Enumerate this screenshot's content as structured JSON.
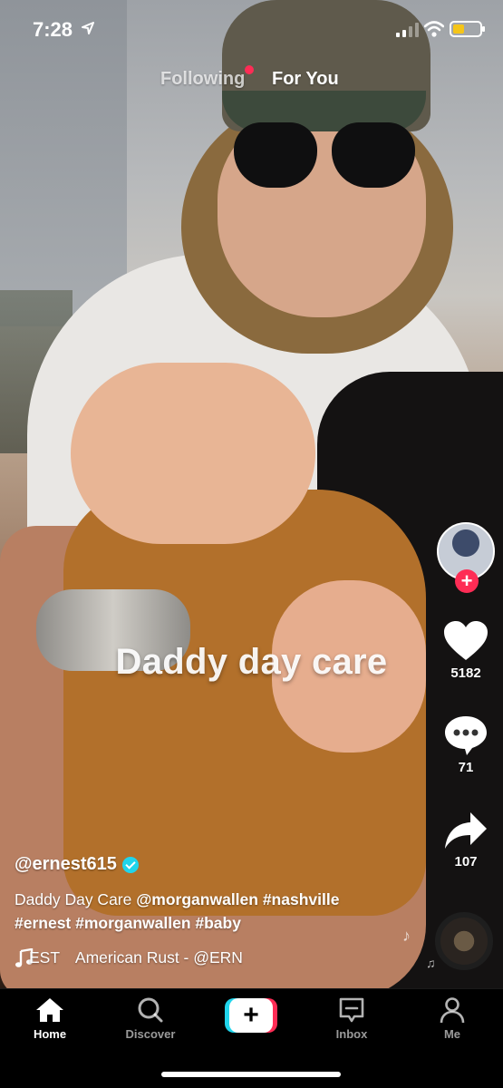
{
  "status_bar": {
    "time": "7:28"
  },
  "top_tabs": {
    "following": "Following",
    "for_you": "For You"
  },
  "video": {
    "overlay_caption": "Daddy day care"
  },
  "actions": {
    "like_count": "5182",
    "comment_count": "71",
    "share_count": "107"
  },
  "post": {
    "username": "@ernest615",
    "description_plain": "Daddy Day Care ",
    "description_bold_1": "@morganwallen #nashville",
    "description_line2": "#ernest #morganwallen #baby"
  },
  "music": {
    "prev_fragment": "EST",
    "title": "American Rust - @ERN"
  },
  "nav": {
    "home": "Home",
    "discover": "Discover",
    "create": "+",
    "inbox": "Inbox",
    "me": "Me"
  },
  "colors": {
    "accent_red": "#fe2c55",
    "accent_cyan": "#20d5ec",
    "battery_yellow": "#f5c518"
  },
  "icons": [
    "location-arrow-icon",
    "signal-icon",
    "wifi-icon",
    "battery-icon",
    "heart-icon",
    "comment-icon",
    "share-icon",
    "verified-icon",
    "music-note-icon",
    "home-icon",
    "search-icon",
    "plus-icon",
    "inbox-icon",
    "person-icon"
  ]
}
